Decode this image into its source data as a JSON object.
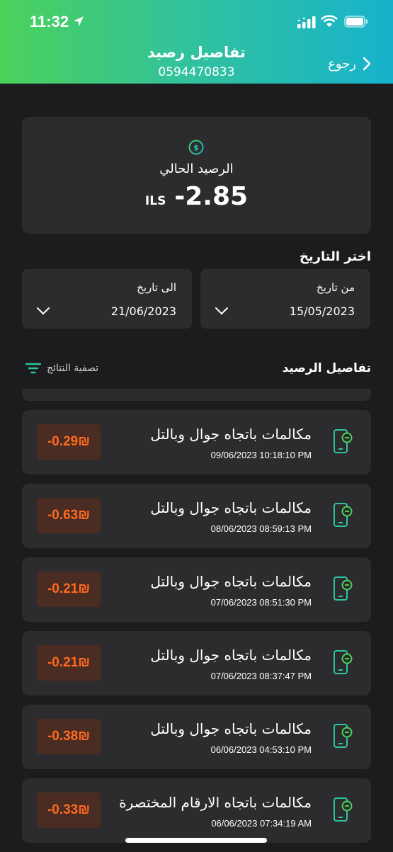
{
  "status": {
    "time": "11:32"
  },
  "header": {
    "title": "تفاصيل رصيد",
    "phone": "0594470833",
    "back_label": "رجوع"
  },
  "balance": {
    "label": "الرصيد الحالي",
    "value": "-2.85",
    "currency": "ILS"
  },
  "dates": {
    "title": "اختر التاريخ",
    "from": {
      "label": "من تاريخ",
      "value": "15/05/2023"
    },
    "to": {
      "label": "الى تاريخ",
      "value": "21/06/2023"
    }
  },
  "details": {
    "title": "تفاصيل الرصيد",
    "filter_label": "تصفية النتائج"
  },
  "transactions": [
    {
      "title": "مكالمات باتجاه جوال وبالتل",
      "datetime": "09/06/2023 10:18:10 PM",
      "amount": "-0.29₪"
    },
    {
      "title": "مكالمات باتجاه جوال وبالتل",
      "datetime": "08/06/2023 08:59:13 PM",
      "amount": "-0.63₪"
    },
    {
      "title": "مكالمات باتجاه جوال وبالتل",
      "datetime": "07/06/2023 08:51:30 PM",
      "amount": "-0.21₪"
    },
    {
      "title": "مكالمات باتجاه جوال وبالتل",
      "datetime": "07/06/2023 08:37:47 PM",
      "amount": "-0.21₪"
    },
    {
      "title": "مكالمات باتجاه جوال وبالتل",
      "datetime": "06/06/2023 04:53:10 PM",
      "amount": "-0.38₪"
    },
    {
      "title": "مكالمات باتجاه الارقام المختصرة",
      "datetime": "06/06/2023 07:34:19 AM",
      "amount": "-0.33₪"
    }
  ],
  "colors": {
    "accent": "#2ec4a0",
    "negative": "#ff6a1f",
    "card": "#2c2c2e",
    "background": "#1c1c1e"
  },
  "icons": {
    "back": "chevron-right-icon",
    "balance": "dollar-coin-icon",
    "filter": "filter-lines-icon",
    "transaction": "phone-minus-icon",
    "dropdown": "chevron-down-icon"
  }
}
